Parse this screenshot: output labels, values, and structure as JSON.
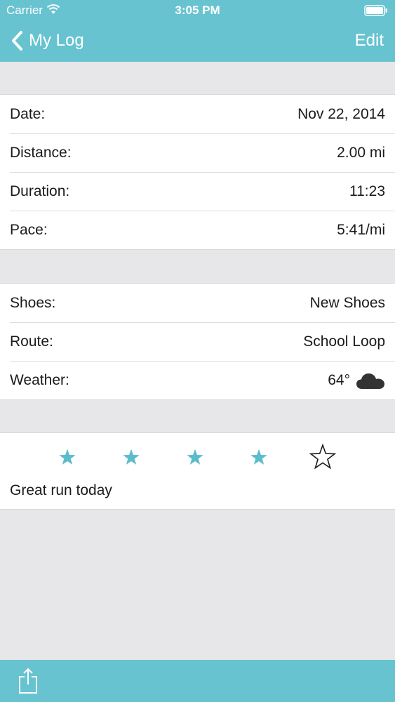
{
  "status_bar": {
    "carrier": "Carrier",
    "time": "3:05 PM",
    "wifi_icon": "wifi-icon",
    "battery_icon": "battery-icon"
  },
  "nav": {
    "back_label": "My Log",
    "back_icon": "chevron-left-icon",
    "edit_label": "Edit"
  },
  "run_stats": [
    {
      "label": "Date:",
      "value": "Nov 22, 2014"
    },
    {
      "label": "Distance:",
      "value": "2.00 mi"
    },
    {
      "label": "Duration:",
      "value": "11:23"
    },
    {
      "label": "Pace:",
      "value": "5:41/mi"
    }
  ],
  "run_details": [
    {
      "label": "Shoes:",
      "value": "New Shoes"
    },
    {
      "label": "Route:",
      "value": "School Loop"
    },
    {
      "label": "Weather:",
      "value": "64°",
      "icon": "cloud-icon"
    }
  ],
  "rating": {
    "value": 4,
    "max": 5,
    "filled_color": "#5bbccb",
    "empty_color": "#1b1b1b"
  },
  "notes": "Great run today",
  "toolbar": {
    "share_icon": "share-icon"
  },
  "colors": {
    "accent": "#67c3d0",
    "background": "#e7e7e9"
  }
}
